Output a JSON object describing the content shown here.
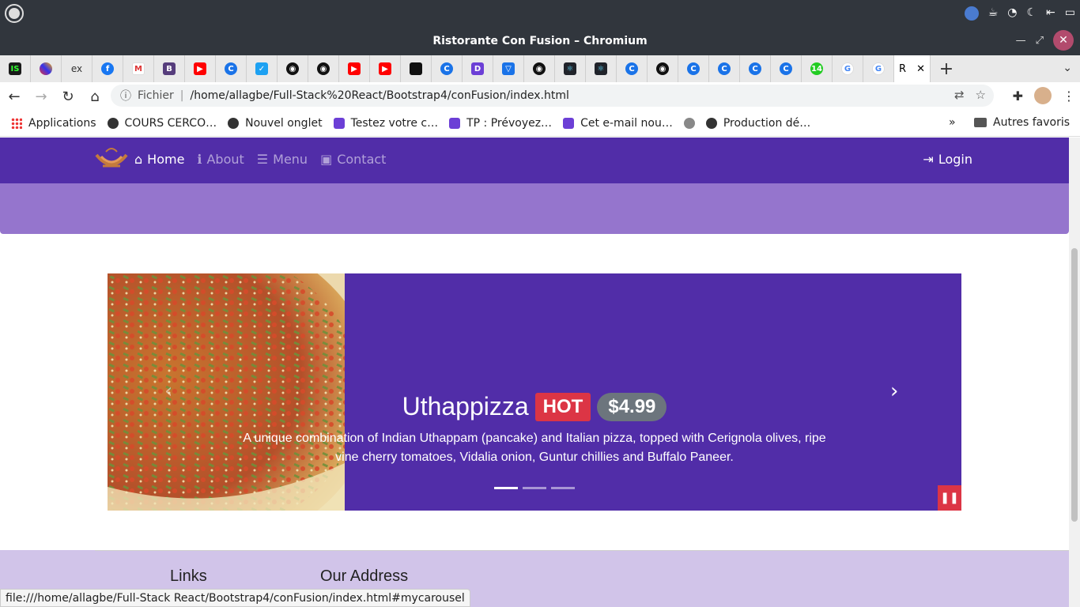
{
  "window": {
    "title": "Ristorante Con Fusion – Chromium"
  },
  "tabs": {
    "active_label": "R",
    "new_tab": "+"
  },
  "addressbar": {
    "scheme": "Fichier",
    "url": "/home/allagbe/Full-Stack%20React/Bootstrap4/conFusion/index.html"
  },
  "bookmarks": {
    "items": [
      "Applications",
      "COURS CERCO…",
      "Nouvel onglet",
      "Testez votre c…",
      "TP : Prévoyez…",
      "Cet e-mail nou…",
      "Production dé…"
    ],
    "more": "»",
    "other": "Autres favoris"
  },
  "navbar": {
    "items": [
      {
        "label": "Home",
        "icon": "home-icon",
        "active": true
      },
      {
        "label": "About",
        "icon": "info-icon",
        "active": false
      },
      {
        "label": "Menu",
        "icon": "list-icon",
        "active": false
      },
      {
        "label": "Contact",
        "icon": "address-card-icon",
        "active": false
      }
    ],
    "login": "Login"
  },
  "carousel": {
    "title": "Uthappizza",
    "badge_hot": "HOT",
    "price": "$4.99",
    "description_line1": "A unique combination of Indian Uthappam (pancake) and Italian pizza, topped with Cerignola olives, ripe",
    "description_line2": "vine cherry tomatoes, Vidalia onion, Guntur chillies and Buffalo Paneer.",
    "indicators": 3,
    "active_indicator": 0
  },
  "footer": {
    "links_heading": "Links",
    "address_heading": "Our Address"
  },
  "statusbar": {
    "text": "file:///home/allagbe/Full-Stack React/Bootstrap4/conFusion/index.html#mycarousel"
  },
  "colors": {
    "primary": "#512DA8",
    "jumbotron": "#9575CD",
    "footer": "#D1C4E9",
    "danger": "#DC3545"
  }
}
